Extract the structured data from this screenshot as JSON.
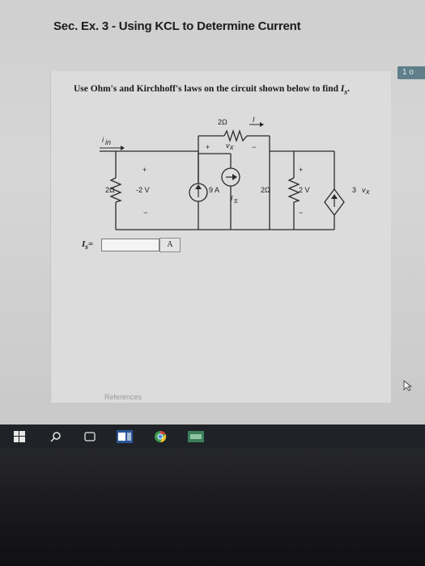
{
  "page": {
    "title": "Sec. Ex. 3 - Using KCL to Determine Current",
    "page_indicator": "1 o"
  },
  "question": {
    "text": "Use Ohm's and Kirchhoff's laws on the circuit shown below to find ",
    "target": "I",
    "target_sub": "s",
    "end": "."
  },
  "circuit": {
    "top_resistor": "2Ω",
    "current_I": "I",
    "current_in": "i",
    "current_in_sub": "in",
    "vx_label": "v",
    "vx_sub": "x",
    "plus": "+",
    "minus": "−",
    "left_resistor": "2Ω",
    "left_voltage": "-2 V",
    "source_9a": "9 A",
    "source_is": "I",
    "source_is_sub": "s",
    "right_resistor": "2Ω",
    "right_voltage": "2 V",
    "dependent_gain": "3",
    "dependent_var": "v",
    "dependent_var_sub": "x"
  },
  "answer": {
    "label": "I",
    "label_sub": "s",
    "equals": "=",
    "value": "",
    "unit": "A"
  },
  "footer": {
    "references": "References"
  },
  "taskbar": {
    "icons": [
      "windows-start-icon",
      "search-icon",
      "task-view-icon",
      "word-icon",
      "chrome-icon",
      "app-icon"
    ]
  },
  "colors": {
    "screen_bg": "#d6d6d6",
    "taskbar_bg": "#1f2226",
    "badge_bg": "#5f7f8a"
  }
}
